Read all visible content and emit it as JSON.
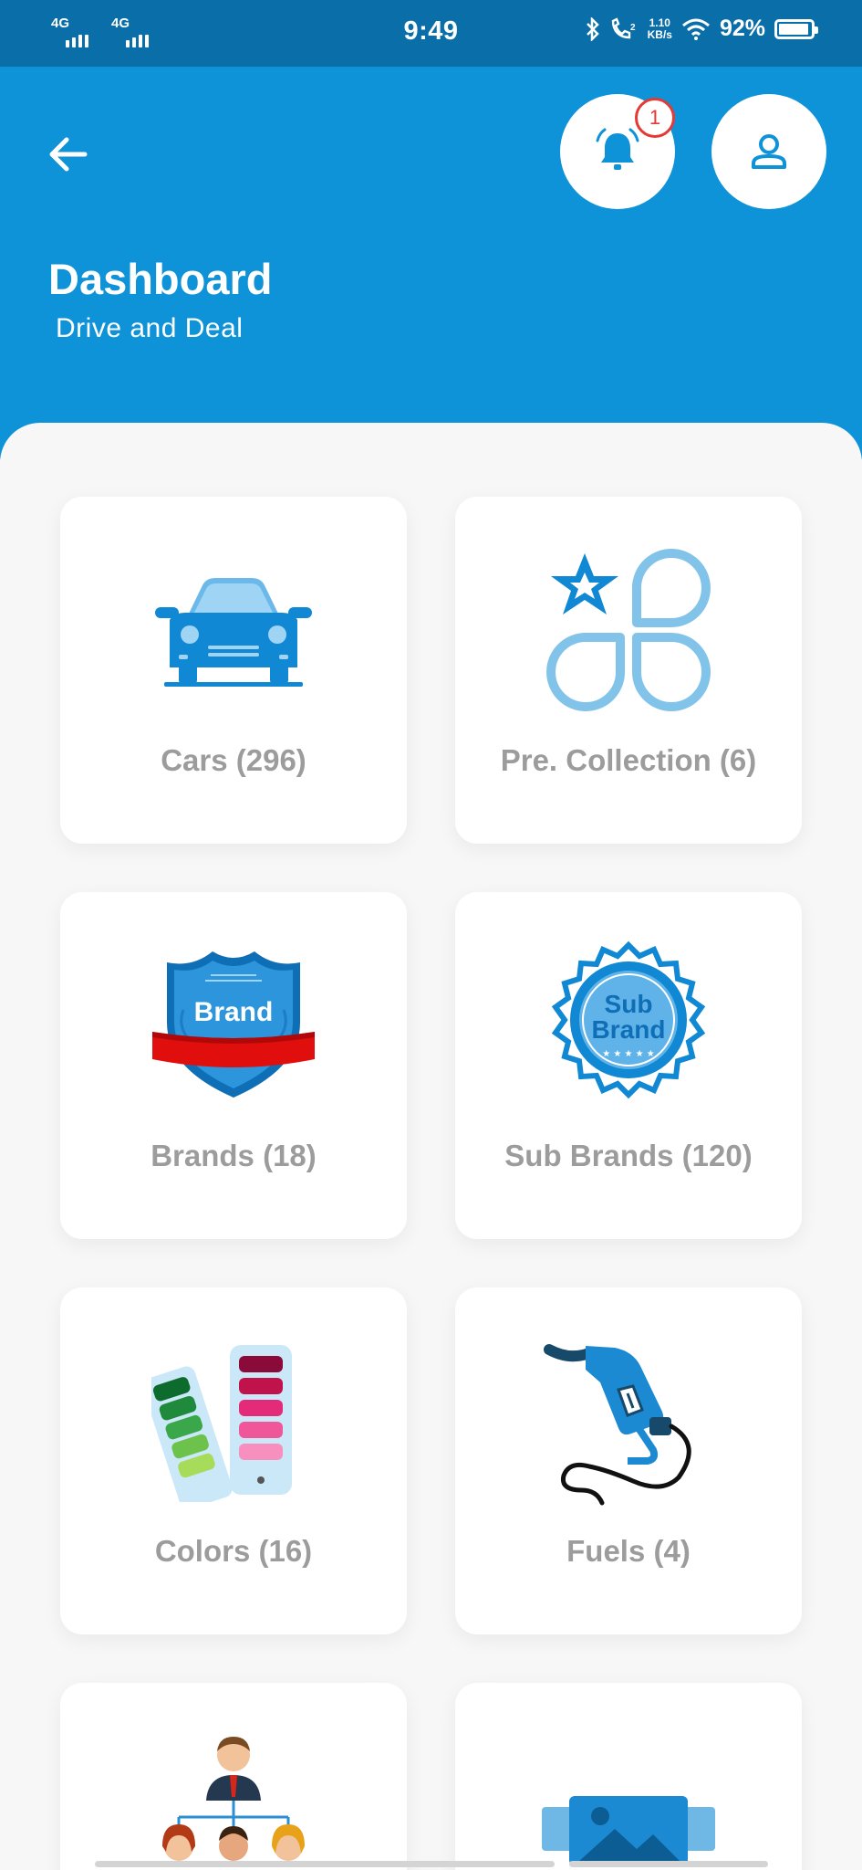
{
  "status_bar": {
    "network_1": "4G",
    "network_2": "4G",
    "time": "9:49",
    "speed_value": "1.10",
    "speed_unit": "KB/s",
    "battery": "92%"
  },
  "header": {
    "title": "Dashboard",
    "subtitle": "Drive and Deal",
    "notification_count": "1",
    "icons": [
      "back-arrow-icon",
      "bell-icon",
      "profile-icon"
    ],
    "color": "#0e92d8"
  },
  "cards": [
    {
      "label": "Cars (296)",
      "icon": "car-icon"
    },
    {
      "label": "Pre. Collection (6)",
      "icon": "collection-icon"
    },
    {
      "label": "Brands (18)",
      "icon": "brand-badge-icon",
      "art_text": "Brand"
    },
    {
      "label": "Sub Brands (120)",
      "icon": "sub-brand-seal-icon",
      "art_text": "Sub Brand"
    },
    {
      "label": "Colors (16)",
      "icon": "color-palette-icon"
    },
    {
      "label": "Fuels (4)",
      "icon": "fuel-nozzle-icon"
    },
    {
      "label": "",
      "icon": "team-hierarchy-icon"
    },
    {
      "label": "",
      "icon": "gallery-image-icon"
    }
  ]
}
